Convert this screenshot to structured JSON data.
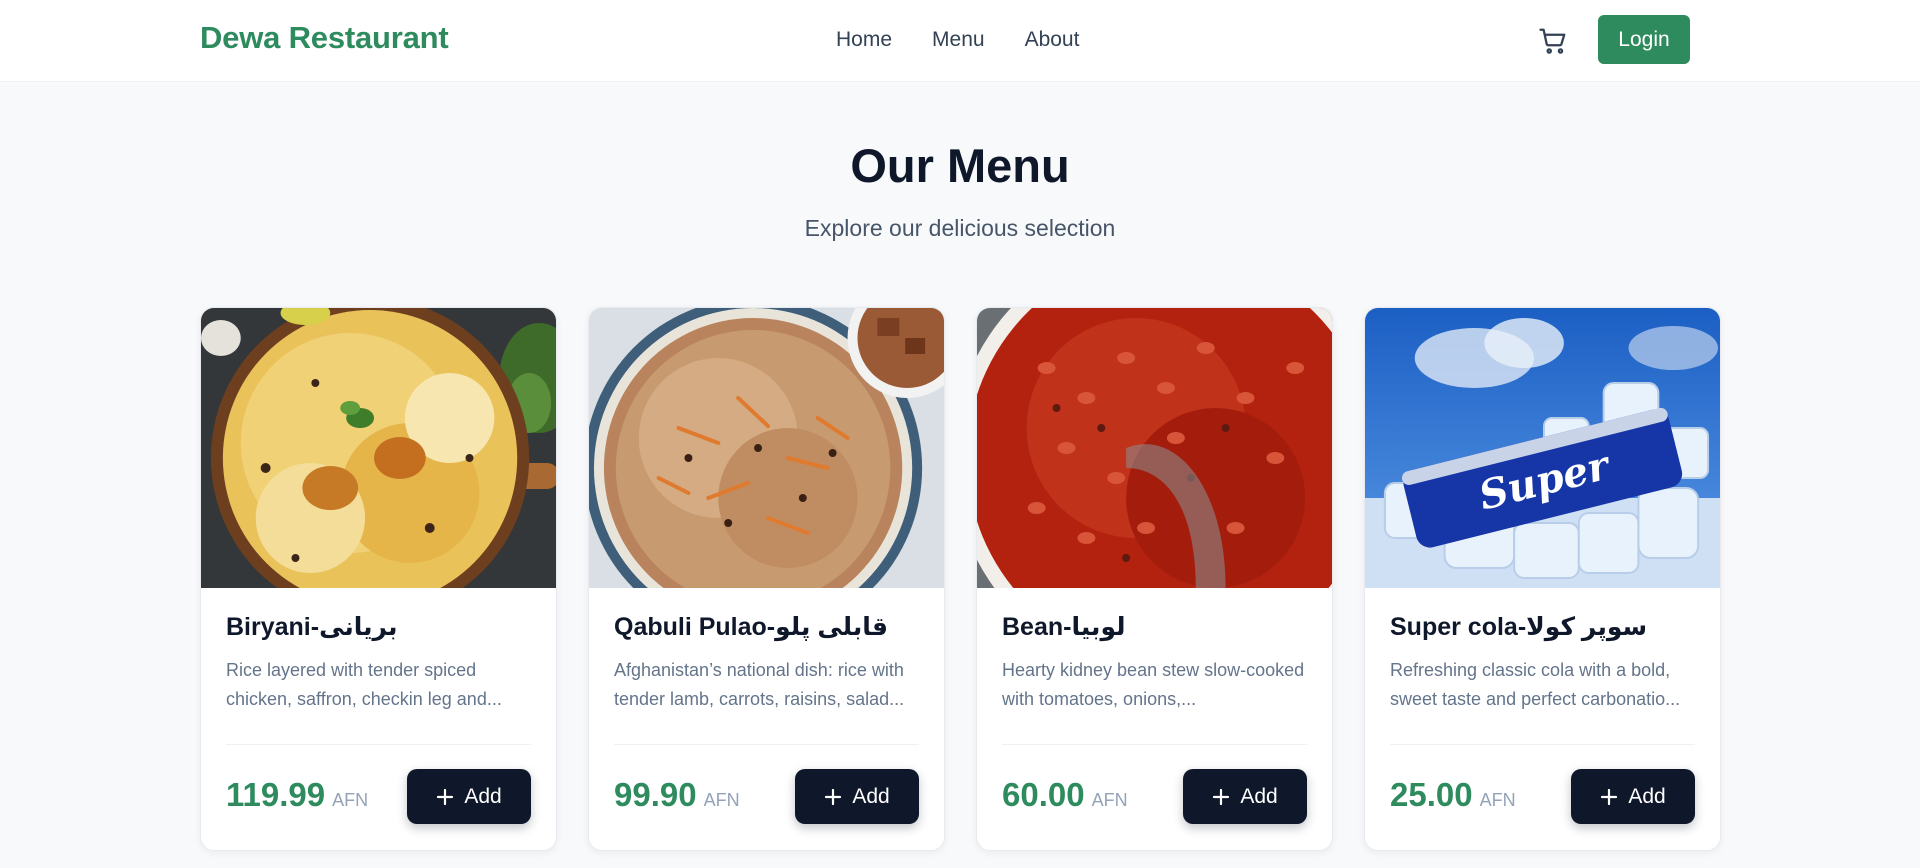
{
  "header": {
    "brand": "Dewa Restaurant",
    "nav": [
      "Home",
      "Menu",
      "About"
    ],
    "cart_icon": "cart-icon",
    "login_label": "Login"
  },
  "hero": {
    "title": "Our Menu",
    "subtitle": "Explore our delicious selection"
  },
  "menu": [
    {
      "title": "Biryani-بریانی",
      "description": "Rice layered with tender spiced chicken, saffron, checkin leg and...",
      "price": "119.99",
      "currency": "AFN",
      "add_label": "Add"
    },
    {
      "title": "Qabuli Pulao-قابلی پلو",
      "description": "Afghanistan’s national dish: rice with tender lamb, carrots, raisins, salad...",
      "price": "99.90",
      "currency": "AFN",
      "add_label": "Add"
    },
    {
      "title": "Bean-لوبیا",
      "description": "Hearty kidney bean stew slow-cooked with tomatoes, onions,...",
      "price": "60.00",
      "currency": "AFN",
      "add_label": "Add"
    },
    {
      "title": "Super cola-سوپر کولا",
      "description": "Refreshing classic cola with a bold, sweet taste and perfect carbonatio...",
      "price": "25.00",
      "currency": "AFN",
      "add_label": "Add"
    }
  ],
  "colors": {
    "brand": "#2e8b5e",
    "dark": "#0f172a",
    "background": "#f8f9fb"
  }
}
